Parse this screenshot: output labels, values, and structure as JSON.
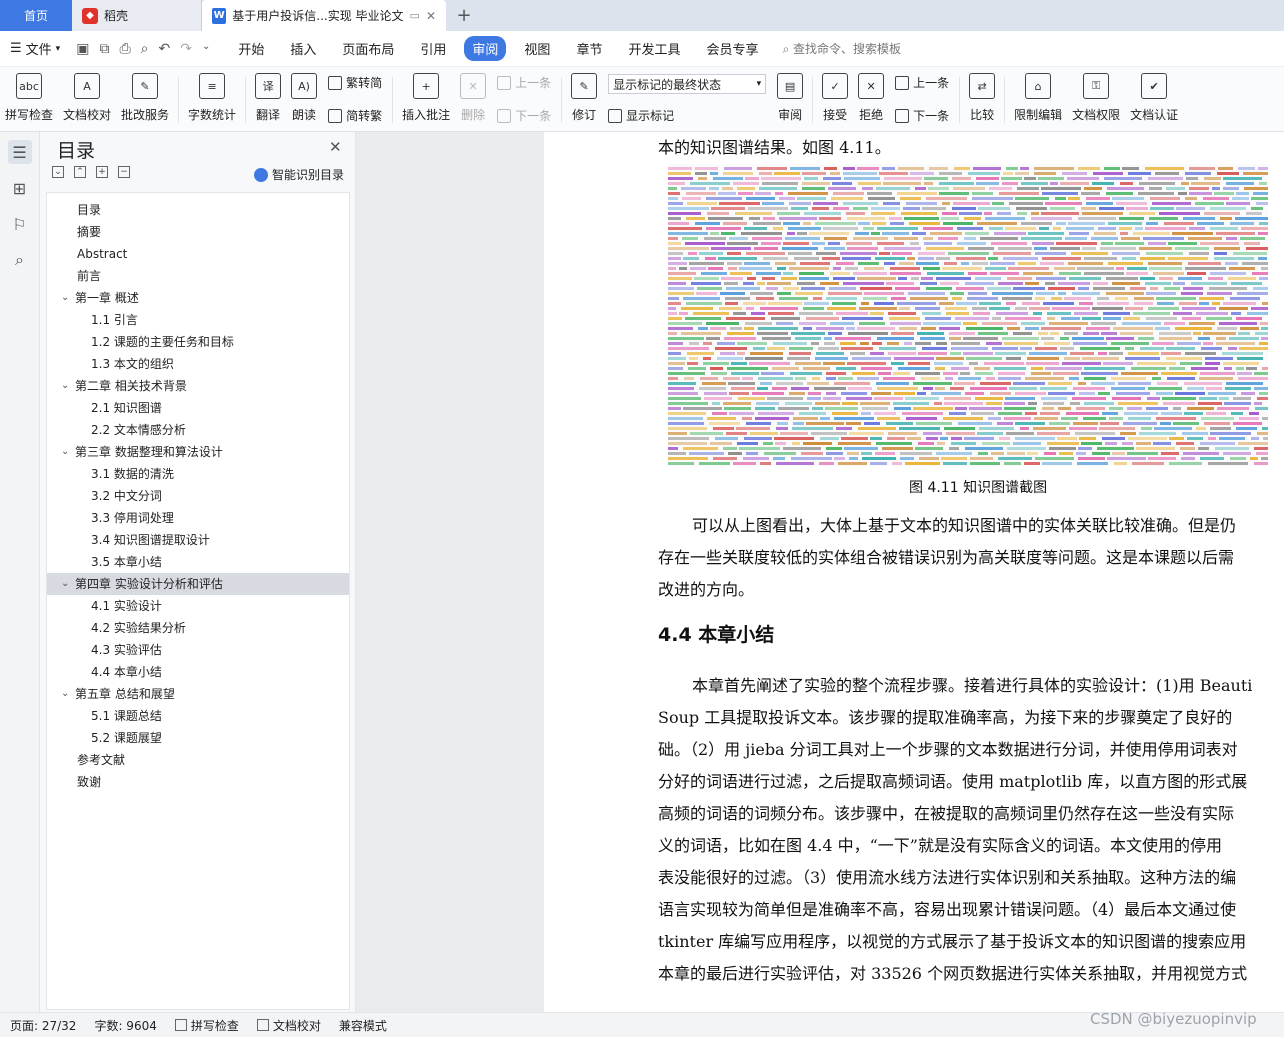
{
  "tabs": {
    "home": "首页",
    "wps": "稻壳",
    "doc": "基于用户投诉信...实现 毕业论文"
  },
  "menu": {
    "file": "文件",
    "items": [
      "开始",
      "插入",
      "页面布局",
      "引用",
      "审阅",
      "视图",
      "章节",
      "开发工具",
      "会员专享"
    ],
    "active": "审阅",
    "search": "查找命令、搜索模板"
  },
  "ribbon": {
    "spellcheck": "拼写检查",
    "proofread": "文档校对",
    "annotate_service": "批改服务",
    "word_count": "字数统计",
    "translate": "翻译",
    "read_aloud": "朗读",
    "trad_simp": "繁转简",
    "simp_trad": "简转繁",
    "insert_comment": "插入批注",
    "delete": "删除",
    "prev": "上一条",
    "next": "下一条",
    "track": "修订",
    "markup_select": "显示标记的最终状态",
    "show_markup": "显示标记",
    "review": "审阅",
    "accept": "接受",
    "reject": "拒绝",
    "prev2": "上一条",
    "next2": "下一条",
    "compare": "比较",
    "restrict": "限制编辑",
    "permission": "文档权限",
    "doc_auth": "文档认证"
  },
  "toc": {
    "title": "目录",
    "smart": "智能识别目录",
    "items": [
      {
        "label": "目录",
        "level": 0
      },
      {
        "label": "摘要",
        "level": 0
      },
      {
        "label": "Abstract",
        "level": 0
      },
      {
        "label": "前言",
        "level": 0
      },
      {
        "label": "第一章  概述",
        "level": "c"
      },
      {
        "label": "1.1 引言",
        "level": 1
      },
      {
        "label": "1.2  课题的主要任务和目标",
        "level": 1
      },
      {
        "label": "1.3 本文的组织",
        "level": 1
      },
      {
        "label": "第二章  相关技术背景",
        "level": "c"
      },
      {
        "label": "2.1  知识图谱",
        "level": 1
      },
      {
        "label": "2.2 文本情感分析",
        "level": 1
      },
      {
        "label": "第三章  数据整理和算法设计",
        "level": "c"
      },
      {
        "label": "3.1 数据的清洗",
        "level": 1
      },
      {
        "label": "3.2 中文分词",
        "level": 1
      },
      {
        "label": "3.3 停用词处理",
        "level": 1
      },
      {
        "label": "3.4 知识图谱提取设计",
        "level": 1
      },
      {
        "label": "3.5 本章小结",
        "level": 1
      },
      {
        "label": "第四章  实验设计分析和评估",
        "level": "c",
        "selected": true
      },
      {
        "label": "4.1 实验设计",
        "level": 1
      },
      {
        "label": "4.2 实验结果分析",
        "level": 1
      },
      {
        "label": "4.3 实验评估",
        "level": 1
      },
      {
        "label": "4.4 本章小结",
        "level": 1
      },
      {
        "label": "第五章  总结和展望",
        "level": "c"
      },
      {
        "label": "5.1 课题总结",
        "level": 1
      },
      {
        "label": "5.2 课题展望",
        "level": 1
      },
      {
        "label": "参考文献",
        "level": 0
      },
      {
        "label": "致谢",
        "level": 0
      }
    ]
  },
  "doc": {
    "line_top": "本的知识图谱结果。如图 4.11。",
    "caption": "图 4.11 知识图谱截图",
    "para1": [
      "可以从上图看出，大体上基于文本的知识图谱中的实体关联比较准确。但是仍",
      "存在一些关联度较低的实体组合被错误识别为高关联度等问题。这是本课题以后需",
      "改进的方向。"
    ],
    "heading": "4.4 本章小结",
    "para2": [
      "本章首先阐述了实验的整个流程步骤。接着进行具体的实验设计：(1)用 Beauti",
      "Soup 工具提取投诉文本。该步骤的提取准确率高，为接下来的步骤奠定了良好的",
      "础。（2）用 jieba 分词工具对上一个步骤的文本数据进行分词，并使用停用词表对",
      "分好的词语进行过滤，之后提取高频词语。使用 matplotlib 库，以直方图的形式展",
      "高频的词语的词频分布。该步骤中，在被提取的高频词里仍然存在这一些没有实际",
      "义的词语，比如在图 4.4 中，“一下”就是没有实际含义的词语。本文使用的停用",
      "表没能很好的过滤。（3）使用流水线方法进行实体识别和关系抽取。这种方法的编",
      "语言实现较为简单但是准确率不高，容易出现累计错误问题。（4）最后本文通过使",
      "tkinter 库编写应用程序，以视觉的方式展示了基于投诉文本的知识图谱的搜索应用",
      "本章的最后进行实验评估，对 33526 个网页数据进行实体关系抽取，并用视觉方式"
    ]
  },
  "status": {
    "page": "页面: 27/32",
    "words": "字数: 9604",
    "spell": "拼写检查",
    "proof": "文档校对",
    "compat": "兼容模式"
  },
  "watermark": "CSDN @biyezuopinvip",
  "colors": {
    "accent": "#3d78e3",
    "wps_red": "#e0332b"
  }
}
